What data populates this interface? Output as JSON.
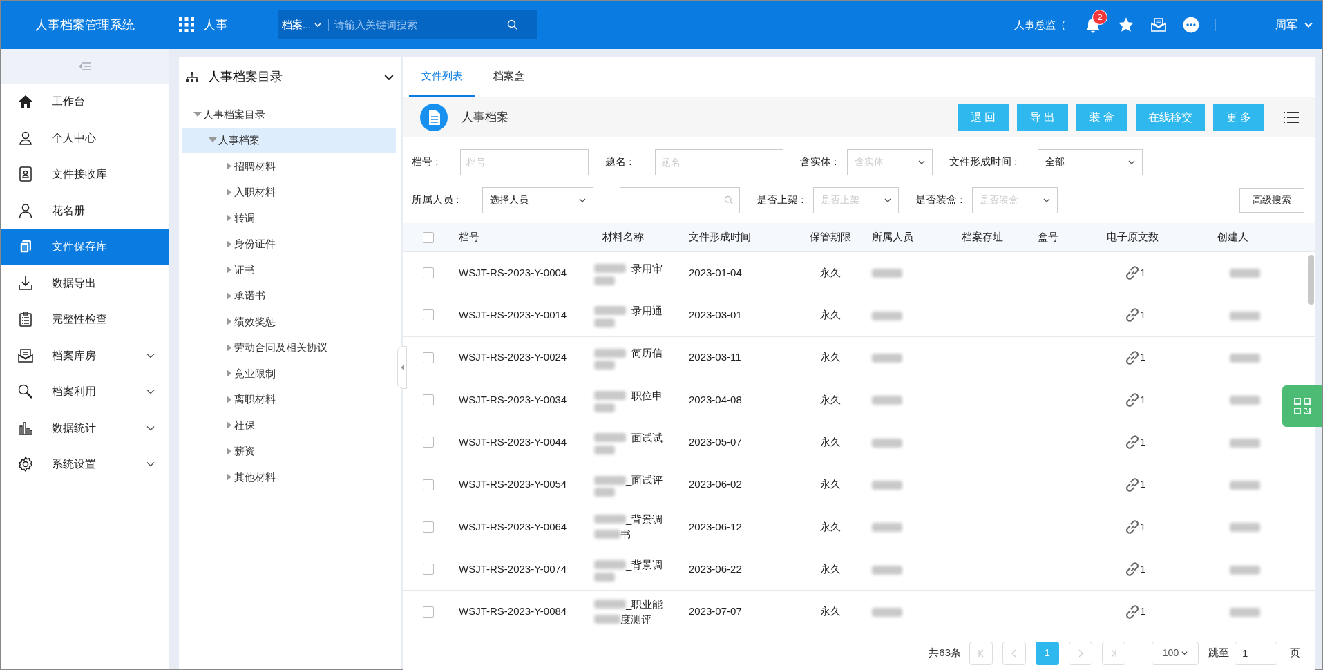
{
  "header": {
    "title": "人事档案管理系统",
    "module": "人事",
    "search_scope": "档案...",
    "search_placeholder": "请输入关键词搜索",
    "role": "人事总监（",
    "notification_count": "2",
    "user": "周军"
  },
  "sidebar": {
    "items": [
      {
        "label": "工作台",
        "selected": false,
        "expandable": false
      },
      {
        "label": "个人中心",
        "selected": false,
        "expandable": false
      },
      {
        "label": "文件接收库",
        "selected": false,
        "expandable": false
      },
      {
        "label": "花名册",
        "selected": false,
        "expandable": false
      },
      {
        "label": "文件保存库",
        "selected": true,
        "expandable": false
      },
      {
        "label": "数据导出",
        "selected": false,
        "expandable": false
      },
      {
        "label": "完整性检查",
        "selected": false,
        "expandable": false
      },
      {
        "label": "档案库房",
        "selected": false,
        "expandable": true
      },
      {
        "label": "档案利用",
        "selected": false,
        "expandable": true
      },
      {
        "label": "数据统计",
        "selected": false,
        "expandable": true
      },
      {
        "label": "系统设置",
        "selected": false,
        "expandable": true
      }
    ]
  },
  "tree": {
    "title": "人事档案目录",
    "items": [
      {
        "label": "人事档案目录",
        "expanded": true,
        "selected": false,
        "children": [
          {
            "label": "人事档案",
            "expanded": true,
            "selected": true,
            "children": [
              {
                "label": "招聘材料",
                "expanded": false,
                "selected": false
              },
              {
                "label": "入职材料",
                "expanded": false,
                "selected": false
              },
              {
                "label": "转调",
                "expanded": false,
                "selected": false
              },
              {
                "label": "身份证件",
                "expanded": false,
                "selected": false
              },
              {
                "label": "证书",
                "expanded": false,
                "selected": false
              },
              {
                "label": "承诺书",
                "expanded": false,
                "selected": false
              },
              {
                "label": "绩效奖惩",
                "expanded": false,
                "selected": false
              },
              {
                "label": "劳动合同及相关协议",
                "expanded": false,
                "selected": false
              },
              {
                "label": "竞业限制",
                "expanded": false,
                "selected": false
              },
              {
                "label": "离职材料",
                "expanded": false,
                "selected": false
              },
              {
                "label": "社保",
                "expanded": false,
                "selected": false
              },
              {
                "label": "薪资",
                "expanded": false,
                "selected": false
              },
              {
                "label": "其他材料",
                "expanded": false,
                "selected": false
              }
            ]
          }
        ]
      }
    ]
  },
  "tabs": [
    {
      "label": "文件列表",
      "selected": true
    },
    {
      "label": "档案盒",
      "selected": false
    }
  ],
  "toolbar": {
    "title": "人事档案",
    "buttons": [
      "退 回",
      "导 出",
      "装 盒",
      "在线移交",
      "更 多"
    ]
  },
  "filters": [
    [
      {
        "label": "档号 :",
        "kind": "text",
        "placeholder": "档号"
      },
      {
        "label": "题名 :",
        "kind": "text",
        "placeholder": "题名"
      },
      {
        "label": "含实体 :",
        "kind": "select",
        "placeholder": "含实体"
      },
      {
        "label": "文件形成时间 :",
        "kind": "select",
        "value": "全部"
      }
    ],
    [
      {
        "label": "所属人员 :",
        "kind": "select",
        "value": "选择人员"
      },
      {
        "kind": "search"
      },
      {
        "label": "是否上架 :",
        "kind": "select",
        "placeholder": "是否上架"
      },
      {
        "label": "是否装盒 :",
        "kind": "select",
        "placeholder": "是否装盒"
      },
      {
        "kind": "button",
        "value": "高级搜索"
      }
    ]
  ],
  "table": {
    "header_checked": false,
    "columns": [
      "档号",
      "材料名称",
      "文件形成时间",
      "保管期限",
      "所属人员",
      "档案存址",
      "盒号",
      "电子原文数",
      "创建人"
    ],
    "rows": [
      {
        "checked": false,
        "code": "WSJT-RS-2023-Y-0004",
        "material": [
          "_录用审"
        ],
        "date": "2023-01-04",
        "retention": "永久",
        "files": "1"
      },
      {
        "checked": false,
        "code": "WSJT-RS-2023-Y-0014",
        "material": [
          "_录用通"
        ],
        "date": "2023-03-01",
        "retention": "永久",
        "files": "1"
      },
      {
        "checked": false,
        "code": "WSJT-RS-2023-Y-0024",
        "material": [
          "_简历信"
        ],
        "date": "2023-03-11",
        "retention": "永久",
        "files": "1"
      },
      {
        "checked": false,
        "code": "WSJT-RS-2023-Y-0034",
        "material": [
          "_职位申"
        ],
        "date": "2023-04-08",
        "retention": "永久",
        "files": "1"
      },
      {
        "checked": false,
        "code": "WSJT-RS-2023-Y-0044",
        "material": [
          "_面试试"
        ],
        "date": "2023-05-07",
        "retention": "永久",
        "files": "1"
      },
      {
        "checked": false,
        "code": "WSJT-RS-2023-Y-0054",
        "material": [
          "_面试评"
        ],
        "date": "2023-06-02",
        "retention": "永久",
        "files": "1"
      },
      {
        "checked": false,
        "code": "WSJT-RS-2023-Y-0064",
        "material": [
          "_背景调",
          "书"
        ],
        "date": "2023-06-12",
        "retention": "永久",
        "files": "1"
      },
      {
        "checked": false,
        "code": "WSJT-RS-2023-Y-0074",
        "material": [
          "_背景调"
        ],
        "date": "2023-06-22",
        "retention": "永久",
        "files": "1"
      },
      {
        "checked": false,
        "code": "WSJT-RS-2023-Y-0084",
        "material": [
          "_职业能",
          "度测评"
        ],
        "date": "2023-07-07",
        "retention": "永久",
        "files": "1"
      }
    ]
  },
  "pagination": {
    "total": "共63条",
    "pages": [
      {
        "label": "1",
        "selected": true
      }
    ],
    "page_size": "100",
    "jump_label": "跳至",
    "jump_value": "1",
    "page_unit": "页"
  }
}
